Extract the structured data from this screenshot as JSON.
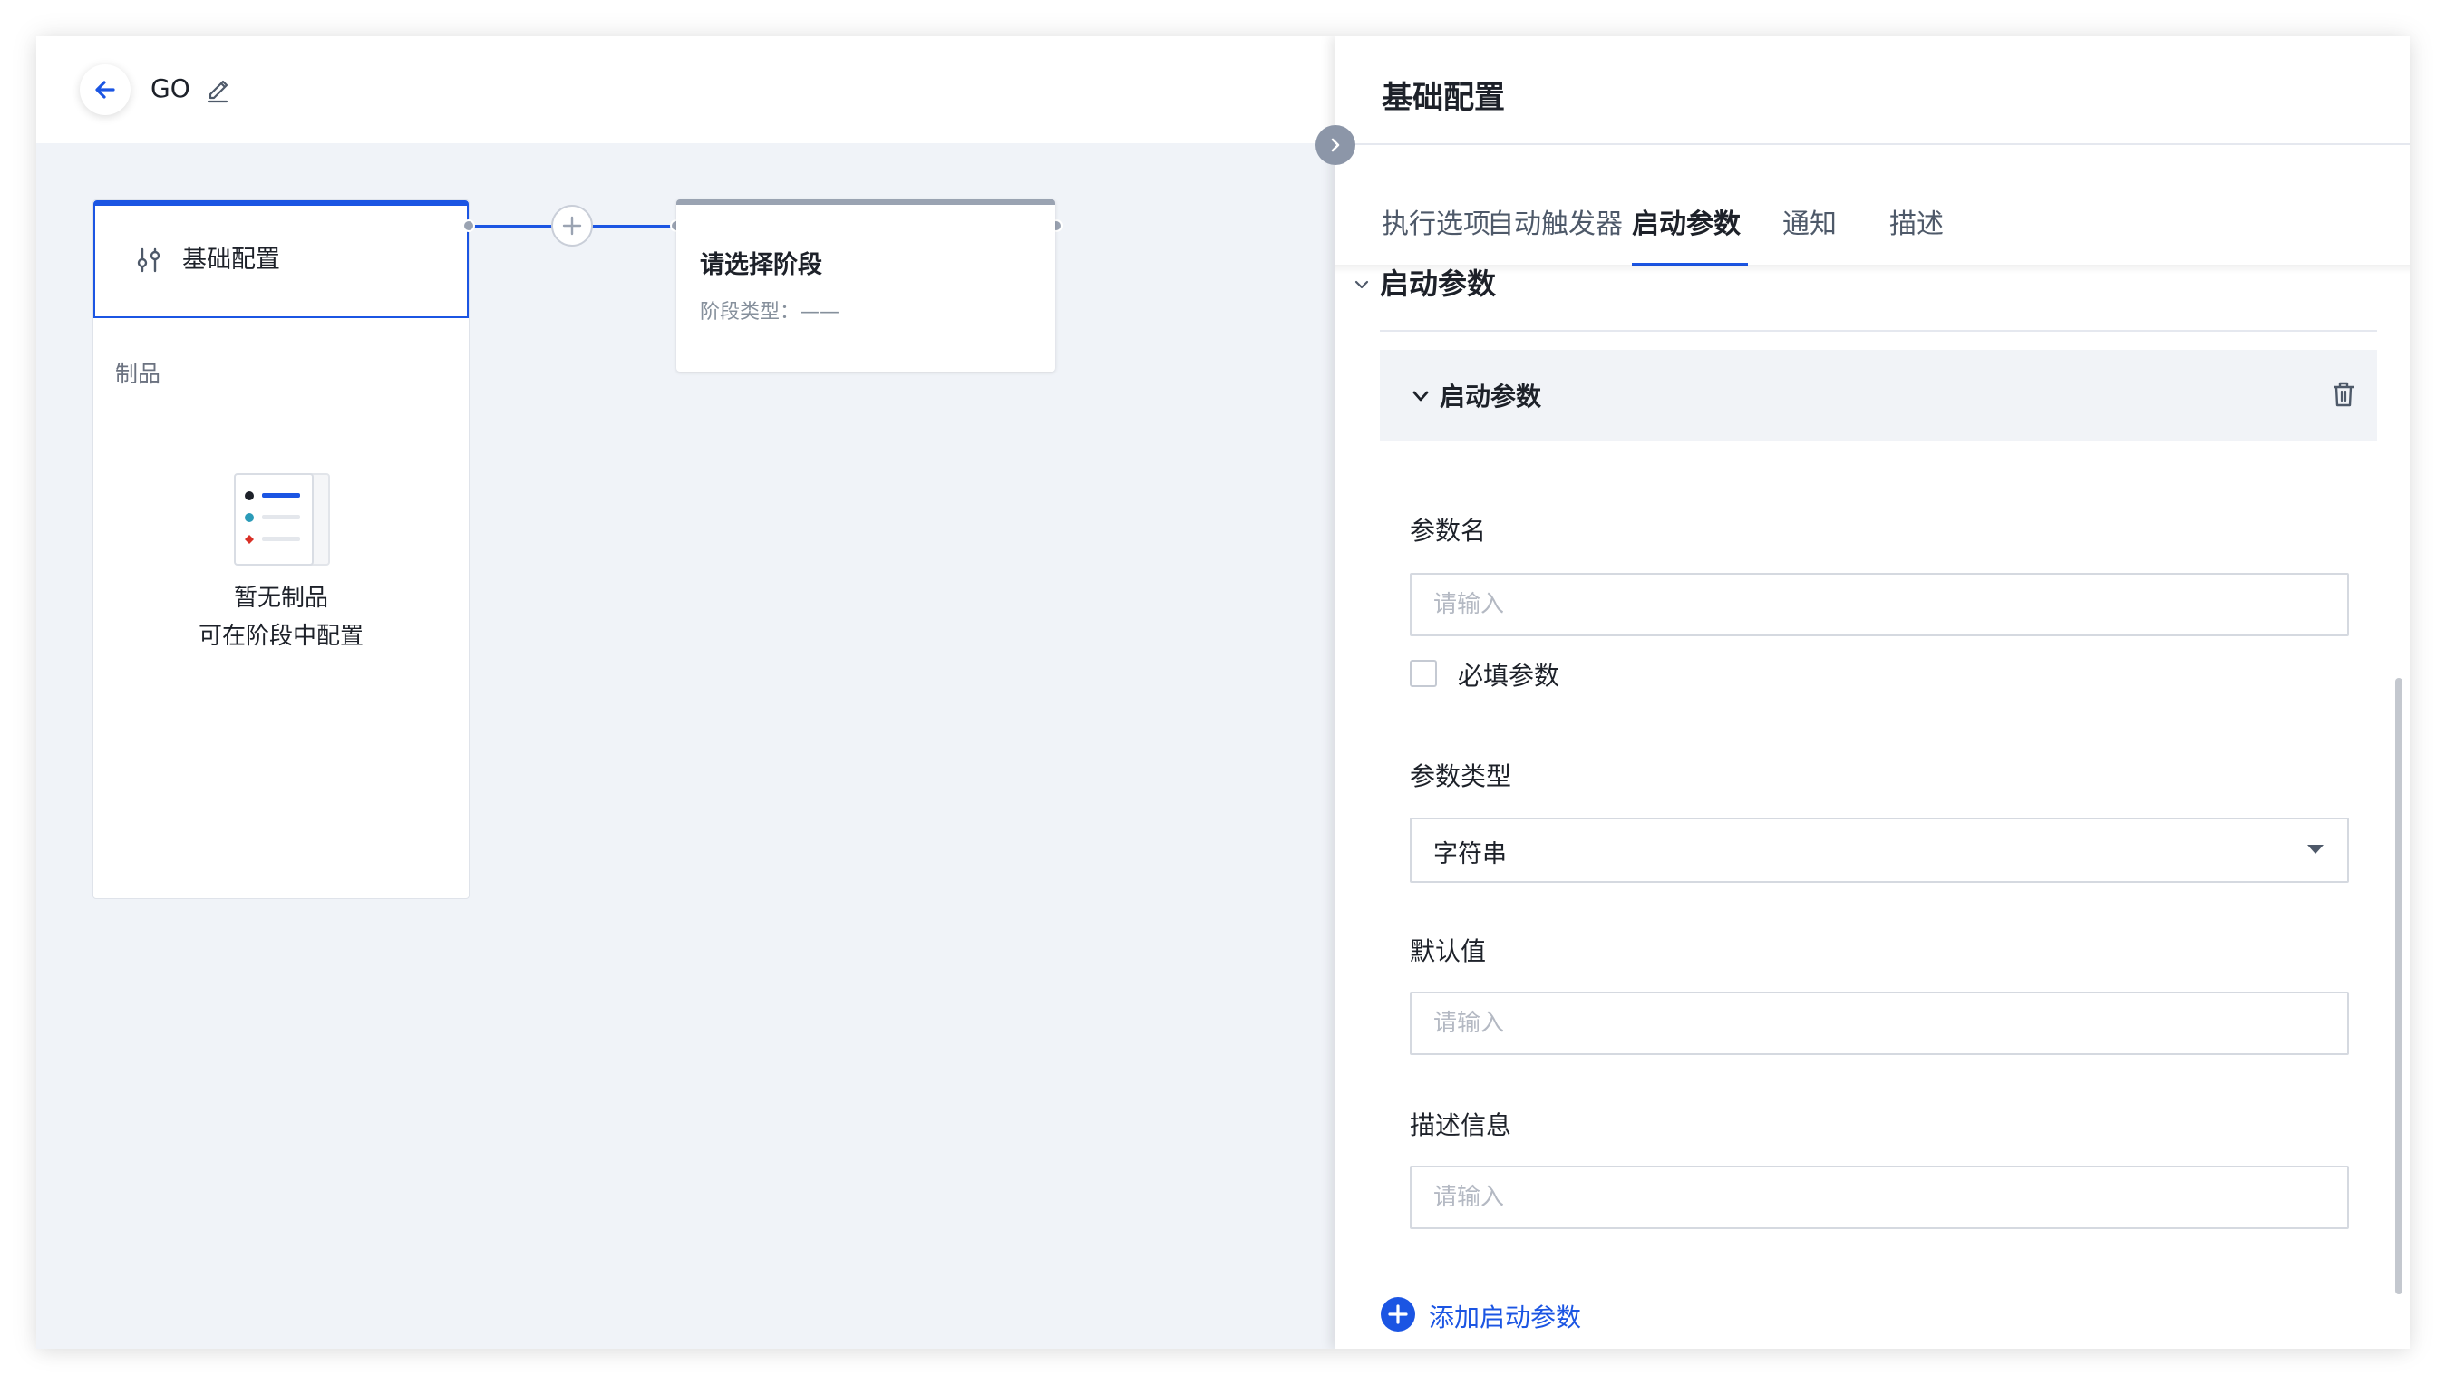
{
  "header": {
    "title": "GO"
  },
  "pipeline": {
    "stage1": {
      "title": "基础配置",
      "artifact_label": "制品",
      "empty_line1": "暂无制品",
      "empty_line2": "可在阶段中配置"
    },
    "stage2": {
      "title": "请选择阶段",
      "type_text": "阶段类型：——"
    }
  },
  "drawer": {
    "title": "基础配置",
    "tabs": [
      {
        "label": "执行选项",
        "active": false
      },
      {
        "label": "自动触发器",
        "active": false
      },
      {
        "label": "启动参数",
        "active": true
      },
      {
        "label": "通知",
        "active": false
      },
      {
        "label": "描述",
        "active": false
      }
    ],
    "section_title": "启动参数",
    "param": {
      "header_title": "启动参数",
      "name_label": "参数名",
      "name_placeholder": "请输入",
      "required_label": "必填参数",
      "type_label": "参数类型",
      "type_value": "字符串",
      "default_label": "默认值",
      "default_placeholder": "请输入",
      "desc_label": "描述信息",
      "desc_placeholder": "请输入"
    },
    "add_param_label": "添加启动参数"
  },
  "icons": {
    "back": "arrow-left-icon",
    "edit": "pencil-icon",
    "stage": "sliders-icon",
    "add": "plus-icon",
    "collapse": "chevron-right-icon",
    "delete": "trash-icon"
  },
  "colors": {
    "accent": "#1b55e3",
    "canvas": "#f0f3f8",
    "node_inactive": "#9aa3b2"
  }
}
